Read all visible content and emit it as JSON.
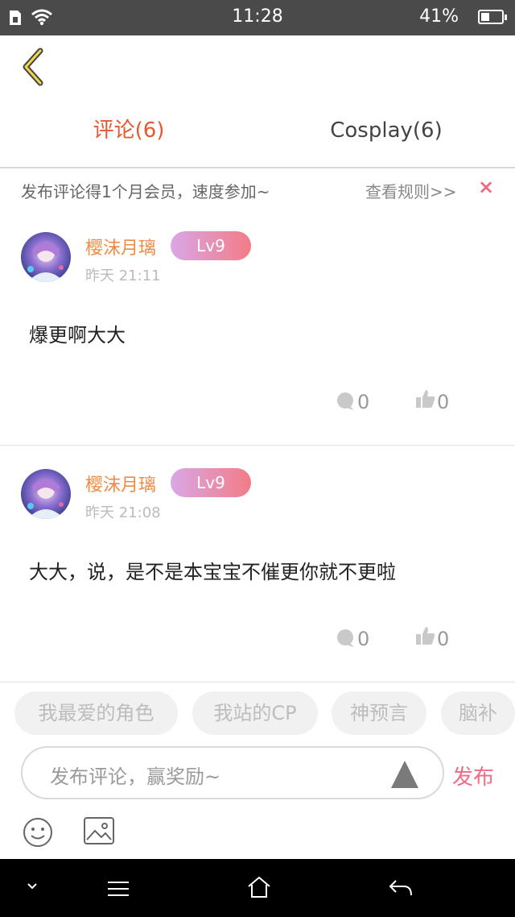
{
  "status_bar": {
    "time": "11:28",
    "battery": "41%",
    "battery_level": 0.41
  },
  "tabs": [
    {
      "label": "评论(6)",
      "active": true
    },
    {
      "label": "Cosplay(6)",
      "active": false
    }
  ],
  "notice": {
    "text": "发布评论得1个月会员，速度参加~",
    "rules": "查看规则>>",
    "close": "×"
  },
  "comments": [
    {
      "user": "樱沫月璃",
      "level": "Lv9",
      "time": "昨天 21:11",
      "text": "爆更啊大大",
      "replies": "0",
      "likes": "0"
    },
    {
      "user": "樱沫月璃",
      "level": "Lv9",
      "time": "昨天 21:08",
      "text": "大大，说，是不是本宝宝不催更你就不更啦",
      "replies": "0",
      "likes": "0"
    }
  ],
  "chips": [
    "我最爱的角色",
    "我站的CP",
    "神预言",
    "脑补"
  ],
  "input": {
    "placeholder": "发布评论，赢奖励~",
    "publish": "发布"
  },
  "colors": {
    "accent": "#e6582e",
    "pink": "#ee6c87",
    "username": "#f08a45"
  },
  "icons": [
    "back-chevron-icon",
    "comment-icon",
    "thumb-up-icon",
    "emoji-icon",
    "image-icon",
    "send-triangle-icon"
  ]
}
